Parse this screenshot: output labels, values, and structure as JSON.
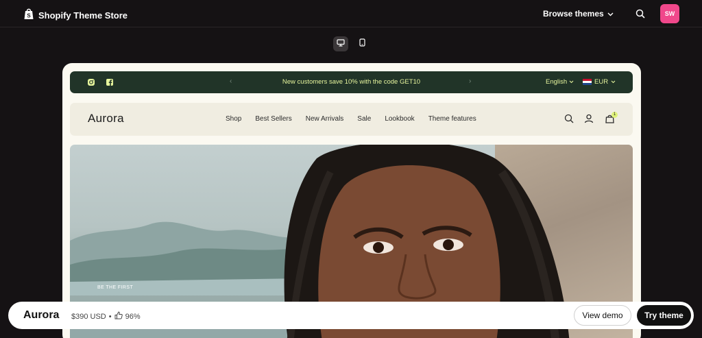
{
  "topbar": {
    "brand": "Shopify Theme Store",
    "browse_label": "Browse themes",
    "avatar_initials": "SW",
    "avatar_color": "#f0488b"
  },
  "device_toggle": {
    "options": [
      "desktop",
      "mobile"
    ],
    "selected": "desktop"
  },
  "preview": {
    "announcement": {
      "text": "New customers save 10% with the code GET10",
      "language": "English",
      "currency": "EUR",
      "social_icons": [
        "instagram-icon",
        "facebook-icon"
      ],
      "bg_color": "#213428",
      "text_color": "#e7f59d"
    },
    "header": {
      "logo": "Aurora",
      "nav": [
        "Shop",
        "Best Sellers",
        "New Arrivals",
        "Sale",
        "Lookbook",
        "Theme features"
      ],
      "cart_count": "1"
    },
    "hero": {
      "tagline": "BE THE FIRST"
    }
  },
  "bottombar": {
    "theme_name": "Aurora",
    "price": "$390 USD",
    "separator": "•",
    "rating": "96%",
    "view_demo": "View demo",
    "try_theme": "Try theme"
  }
}
